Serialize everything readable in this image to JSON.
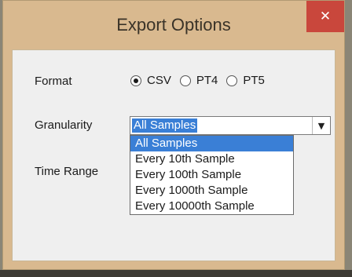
{
  "window": {
    "title": "Export Options",
    "close_label": "✕"
  },
  "format": {
    "label": "Format",
    "options": [
      {
        "label": "CSV",
        "checked": true
      },
      {
        "label": "PT4",
        "checked": false
      },
      {
        "label": "PT5",
        "checked": false
      }
    ]
  },
  "granularity": {
    "label": "Granularity",
    "selected": "All Samples",
    "options": [
      "All Samples",
      "Every 10th Sample",
      "Every 100th Sample",
      "Every 1000th Sample",
      "Every 10000th Sample"
    ]
  },
  "time_range": {
    "label": "Time Range"
  },
  "colors": {
    "titlebar": "#d9b98f",
    "close_button": "#c9473c",
    "selection": "#3a7fd6",
    "client": "#efefef"
  }
}
